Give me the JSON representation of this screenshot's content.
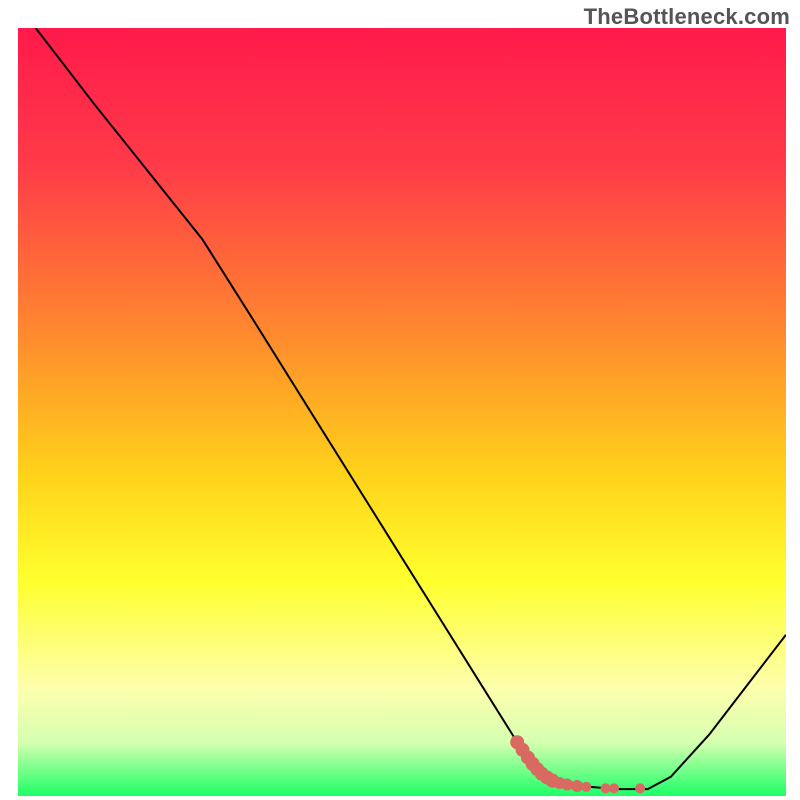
{
  "watermark": {
    "text": "TheBottleneck.com"
  },
  "chart_data": {
    "type": "line",
    "title": "",
    "xlabel": "",
    "ylabel": "",
    "xlim": [
      0,
      100
    ],
    "ylim": [
      0,
      100
    ],
    "grid": false,
    "legend": false,
    "gradient_stops": [
      {
        "offset": 0,
        "color": "#ff1a4b"
      },
      {
        "offset": 18,
        "color": "#ff3b48"
      },
      {
        "offset": 40,
        "color": "#ff8a2e"
      },
      {
        "offset": 58,
        "color": "#ffd21a"
      },
      {
        "offset": 72,
        "color": "#ffff2e"
      },
      {
        "offset": 86,
        "color": "#fdffad"
      },
      {
        "offset": 93,
        "color": "#d6ffb0"
      },
      {
        "offset": 100,
        "color": "#1dff66"
      }
    ],
    "series": [
      {
        "name": "curve",
        "type": "line",
        "color": "#000000",
        "width": 2,
        "points": [
          {
            "x": 2.3,
            "y": 100.0
          },
          {
            "x": 10.0,
            "y": 90.0
          },
          {
            "x": 18.0,
            "y": 80.0
          },
          {
            "x": 24.0,
            "y": 72.5
          },
          {
            "x": 30.0,
            "y": 63.0
          },
          {
            "x": 40.0,
            "y": 47.0
          },
          {
            "x": 50.0,
            "y": 31.0
          },
          {
            "x": 60.0,
            "y": 15.0
          },
          {
            "x": 65.0,
            "y": 7.0
          },
          {
            "x": 68.0,
            "y": 2.8
          },
          {
            "x": 72.0,
            "y": 1.4
          },
          {
            "x": 78.0,
            "y": 0.9
          },
          {
            "x": 82.0,
            "y": 0.9
          },
          {
            "x": 85.0,
            "y": 2.5
          },
          {
            "x": 90.0,
            "y": 8.0
          },
          {
            "x": 95.0,
            "y": 14.5
          },
          {
            "x": 100.0,
            "y": 21.0
          }
        ]
      },
      {
        "name": "markers",
        "type": "scatter",
        "color": "#d86a62",
        "points": [
          {
            "x": 65.0,
            "y": 7.0,
            "r": 7
          },
          {
            "x": 65.7,
            "y": 6.0,
            "r": 7
          },
          {
            "x": 66.4,
            "y": 5.0,
            "r": 7
          },
          {
            "x": 67.0,
            "y": 4.2,
            "r": 7
          },
          {
            "x": 67.6,
            "y": 3.5,
            "r": 7
          },
          {
            "x": 68.2,
            "y": 2.9,
            "r": 7
          },
          {
            "x": 68.9,
            "y": 2.4,
            "r": 7
          },
          {
            "x": 69.6,
            "y": 2.0,
            "r": 7
          },
          {
            "x": 70.5,
            "y": 1.7,
            "r": 6
          },
          {
            "x": 71.5,
            "y": 1.5,
            "r": 6
          },
          {
            "x": 72.8,
            "y": 1.3,
            "r": 6
          },
          {
            "x": 74.0,
            "y": 1.2,
            "r": 5
          },
          {
            "x": 76.5,
            "y": 1.0,
            "r": 5
          },
          {
            "x": 77.6,
            "y": 1.0,
            "r": 5
          },
          {
            "x": 81.0,
            "y": 1.0,
            "r": 5
          }
        ]
      }
    ]
  }
}
